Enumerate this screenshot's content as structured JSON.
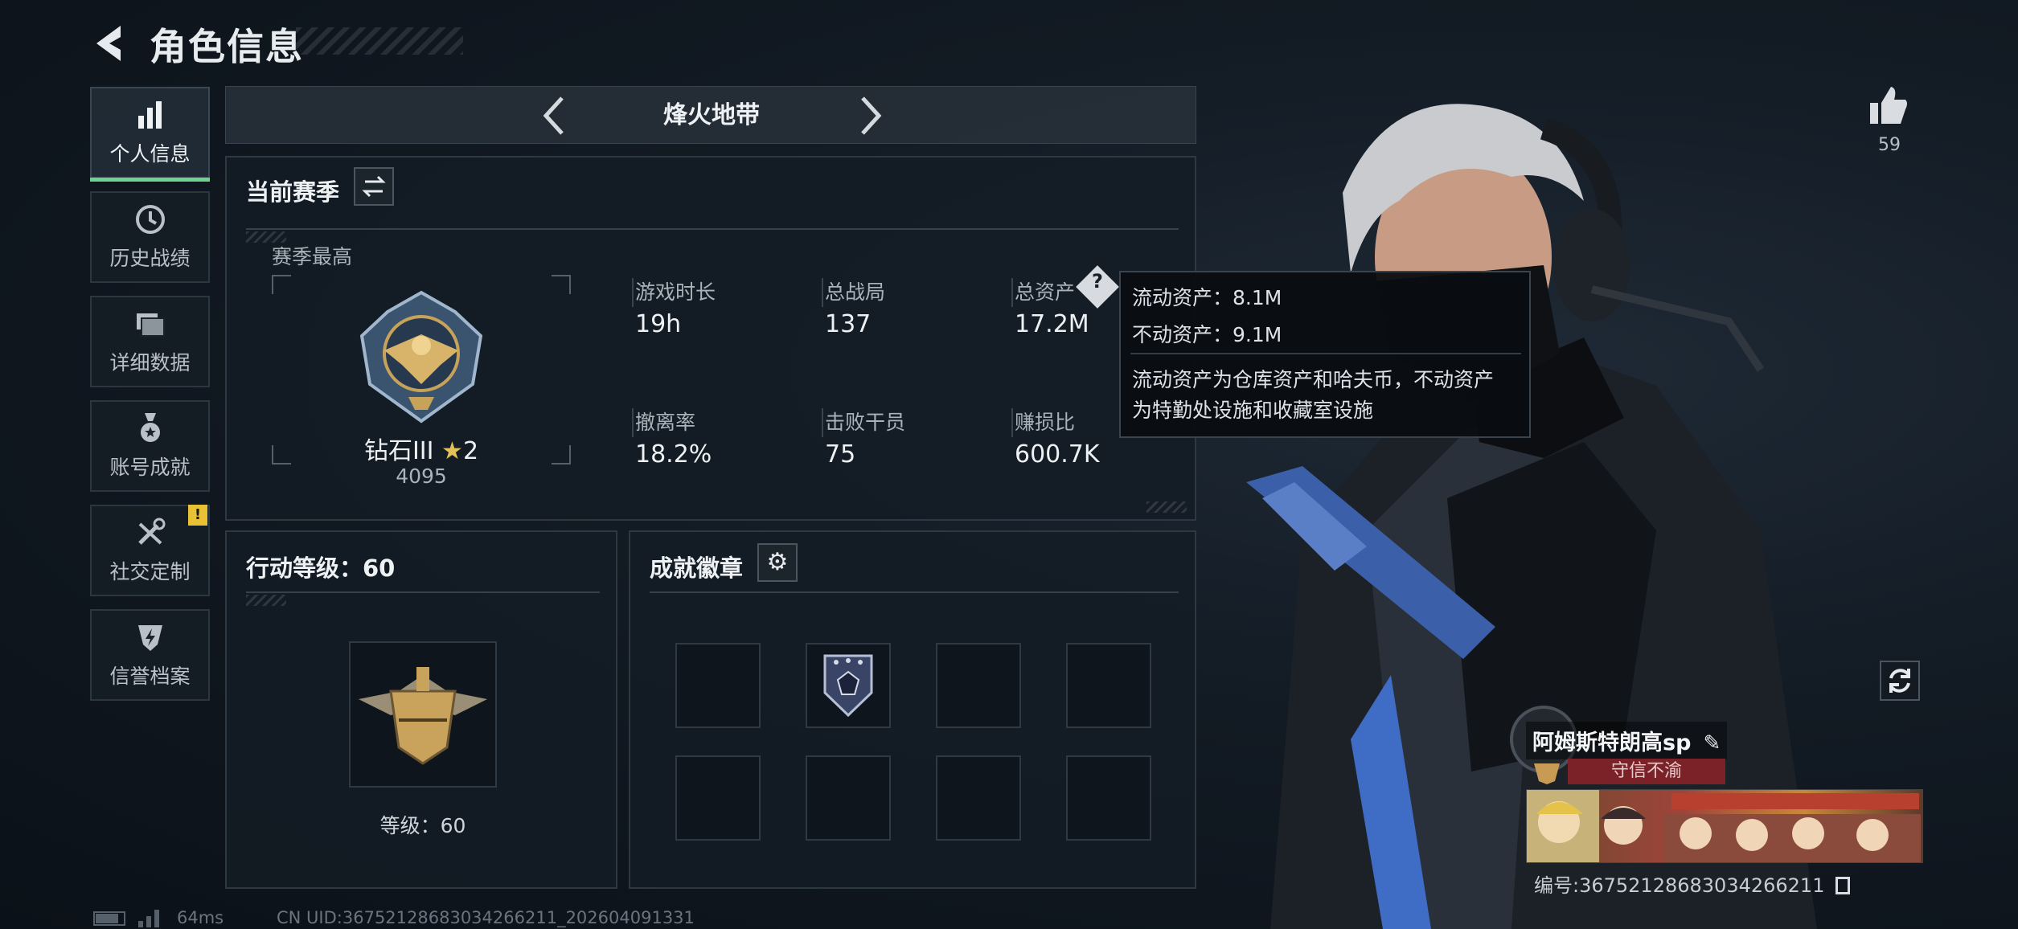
{
  "header": {
    "title": "角色信息"
  },
  "sidebar": {
    "items": [
      {
        "label": "个人信息",
        "icon": "bar-chart-icon",
        "active": true
      },
      {
        "label": "历史战绩",
        "icon": "clock-history-icon"
      },
      {
        "label": "详细数据",
        "icon": "folders-icon"
      },
      {
        "label": "账号成就",
        "icon": "medal-icon"
      },
      {
        "label": "社交定制",
        "icon": "tools-icon"
      },
      {
        "label": "信誉档案",
        "icon": "shield-lightning-icon"
      }
    ],
    "alert_badge": "!"
  },
  "mode": {
    "title": "烽火地带"
  },
  "season": {
    "title": "当前赛季",
    "peak_label": "赛季最高",
    "rank_name": "钻石III",
    "rank_stars": "2",
    "rank_points": "4095",
    "stats": [
      {
        "label": "游戏时长",
        "value": "19h"
      },
      {
        "label": "总战局",
        "value": "137"
      },
      {
        "label": "总资产",
        "value": "17.2M"
      },
      {
        "label": "撤离率",
        "value": "18.2%"
      },
      {
        "label": "击败干员",
        "value": "75"
      },
      {
        "label": "赚损比",
        "value": "600.7K"
      }
    ]
  },
  "tooltip": {
    "line1": "流动资产：8.1M",
    "line2": "不动资产：9.1M",
    "desc1": "流动资产为仓库资产和哈夫币，不动资产",
    "desc2": "为特勤处设施和收藏室设施"
  },
  "action_level": {
    "title": "行动等级：60",
    "level_text": "等级：60"
  },
  "badges": {
    "title": "成就徽章"
  },
  "player": {
    "likes": "59",
    "name": "阿姆斯特朗高sp",
    "motto": "守信不渝",
    "id_text": "编号:3675212868303426621​1"
  },
  "footer": {
    "ping": "64ms",
    "uid": "CN UID:3675212868303426621​1_202604091331"
  },
  "colors": {
    "active_indicator": "#6fd28c",
    "alert": "#e8c234",
    "motto_bg": "#7a2227"
  }
}
